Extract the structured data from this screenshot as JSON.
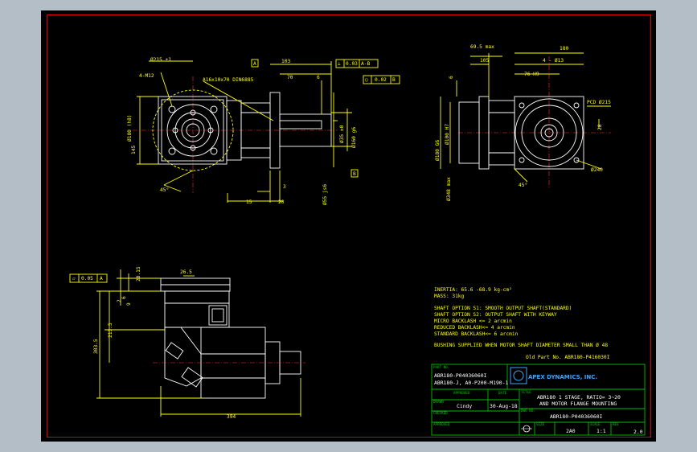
{
  "colors": {
    "window_bg": "#b4bec6",
    "canvas": "#000000",
    "border": "#e00000",
    "line_yellow": "#ffff00",
    "line_white": "#ffffff",
    "title_green": "#00c000",
    "logo_blue": "#3aa6ff"
  },
  "top_view": {
    "dims": [
      "Ø215 ±1",
      "4-M12",
      "Ø180 (h8)",
      "145",
      "A16x10x70 DIN6885",
      "103",
      "70",
      "6",
      "Ø35 ±0",
      "Ø160 g6",
      "Ø55 js6",
      "15",
      "3",
      "20",
      "45°"
    ],
    "datum_a": "A",
    "datum_b": "B",
    "tol1": {
      "sym": "⊥",
      "value": "0.03",
      "ref": "A-B"
    },
    "tol2": {
      "sym": "○",
      "value": "0.02",
      "ref": "B"
    }
  },
  "side_view": {
    "dims": [
      "69.5 max",
      "180",
      "105",
      "4 - Ø13",
      "76 H9",
      "PCD Ø215",
      "Ø180 G6",
      "Ø100 H7",
      "Ø240",
      "Ø348 max",
      "45°",
      "6",
      "28",
      "22",
      "4.5"
    ]
  },
  "front_view": {
    "tol": {
      "value": "0.05",
      "ref": "A"
    },
    "dims": [
      "26.5",
      "20.15",
      "2",
      "6",
      "9",
      "213.5",
      "303.5",
      "394"
    ]
  },
  "notes": {
    "inertia": "INERTIA:   65.6 -68.9 kg-cm²",
    "mass": "MASS: 31kg",
    "lines": [
      "SHAFT OPTION S1: SMOOTH OUTPUT SHAFT(STANDARD)",
      "SHAFT OPTION S2: OUTPUT SHAFT WITH KEYWAY",
      "MICRO BACKLASH <= 2 arcmin",
      "REDUCED BACKLASH<= 4 arcmin",
      "STANDARD BACKLASH<= 6 arcmin"
    ],
    "bushing": "BUSHING SUPPLIED WHEN MOTOR SHAFT DIAMETER SMALL THAN Ø 48",
    "old_part": "Old Part No. ABR180-P416030I"
  },
  "title_block": {
    "part_no_label": "PART NO.",
    "part_no_1": "ABR180-P04036060I",
    "part_no_2": "ABR180-J, A0-P200-M190-1",
    "company": "APEX DYNAMICS, INC.",
    "approved_label": "APPROVED",
    "date_label": "DATE",
    "drawn_label": "DRAWN",
    "drawn_by": "Cindy",
    "date": "30-Aug-18",
    "checked_label": "CHECKED",
    "title_label": "TITLE",
    "title_1": "ABR180 1 STAGE, RATIO= 3~20",
    "title_2": "AND MOTOR FLANGE MOUNTING",
    "approved2_label": "APPROVED",
    "dwg_no_label": "DWG NO.",
    "dwg_no": "ABR180-P04036060I",
    "size_label": "SIZE",
    "scale_label": "SCALE",
    "rev_label": "REV",
    "size": "2A0",
    "scale": "1:1",
    "rev": "2.0"
  }
}
